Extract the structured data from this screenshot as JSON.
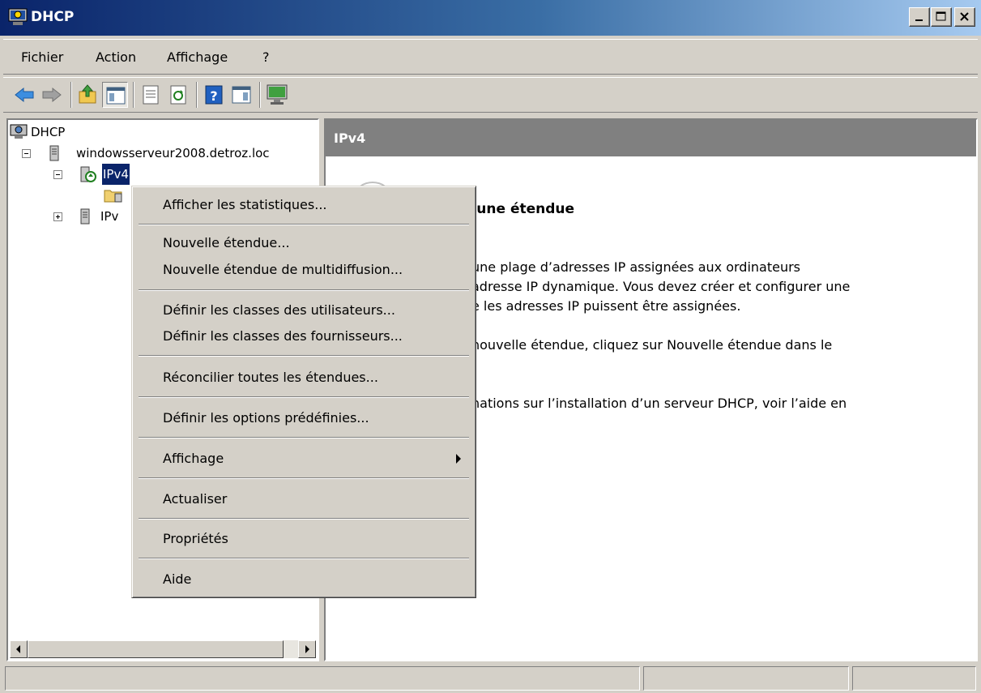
{
  "window": {
    "title": "DHCP"
  },
  "menubar": [
    "Fichier",
    "Action",
    "Affichage",
    "?"
  ],
  "toolbar": {
    "buttons": [
      "back-arrow-icon",
      "forward-arrow-icon",
      "up-folder-icon",
      "show-hide-console-tree-icon",
      "export-list-icon",
      "refresh-icon",
      "help-icon",
      "show-hide-action-pane-icon",
      "dhcp-console-icon"
    ]
  },
  "tree": {
    "root": "DHCP",
    "server": "windowsserveur2008.detroz.loc",
    "ipv4": "IPv4",
    "ipv6": "IPv"
  },
  "right_pane": {
    "header": "IPv4",
    "heading": "r une étendue",
    "lines": [
      "une plage d’adresses IP assignées aux ordinateurs",
      "adresse IP dynamique. Vous devez créer et configurer une",
      "e les adresses IP puissent être assignées.",
      "nouvelle étendue, cliquez sur Nouvelle étendue dans le",
      "nations sur l’installation d’un serveur DHCP, voir l’aide en"
    ]
  },
  "context_menu": {
    "stats": "Afficher les statistiques...",
    "new_scope": "Nouvelle étendue...",
    "new_multicast": "Nouvelle étendue de multidiffusion...",
    "user_classes": "Définir les classes des utilisateurs...",
    "vendor_classes": "Définir les classes des fournisseurs...",
    "reconcile": "Réconcilier toutes les étendues...",
    "predefined": "Définir les options prédéfinies...",
    "view": "Affichage",
    "refresh": "Actualiser",
    "properties": "Propriétés",
    "help": "Aide"
  }
}
